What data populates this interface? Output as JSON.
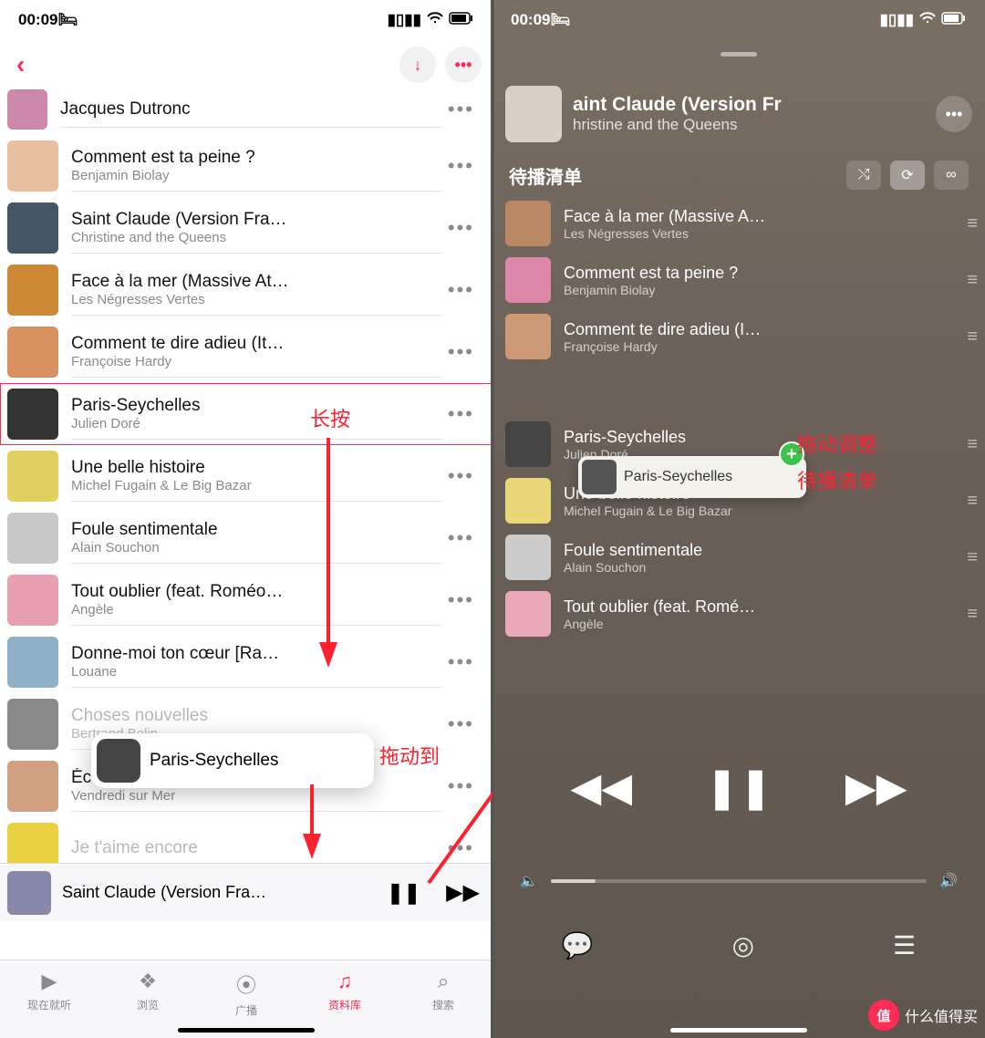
{
  "status": {
    "time": "00:09",
    "icons": {
      "signal": "▮▮",
      "wifi": "⎋",
      "battery": "▮"
    }
  },
  "left": {
    "nav": {
      "back": "‹",
      "download": "↓",
      "more": "•••"
    },
    "songs": [
      {
        "title": "Jacques Dutronc",
        "artist": "",
        "first": true
      },
      {
        "title": "Comment est ta peine ?",
        "artist": "Benjamin Biolay"
      },
      {
        "title": "Saint Claude (Version Fra…",
        "artist": "Christine and the Queens"
      },
      {
        "title": "Face à la mer (Massive At…",
        "artist": "Les Négresses Vertes"
      },
      {
        "title": "Comment te dire adieu (It…",
        "artist": "Françoise Hardy"
      },
      {
        "title": "Paris-Seychelles",
        "artist": "Julien Doré",
        "highlight": true
      },
      {
        "title": "Une belle histoire",
        "artist": "Michel Fugain & Le Big Bazar"
      },
      {
        "title": "Foule sentimentale",
        "artist": "Alain Souchon"
      },
      {
        "title": "Tout oublier (feat. Roméo…",
        "artist": "Angèle"
      },
      {
        "title": "Donne-moi ton cœur [Ra…",
        "artist": "Louane"
      },
      {
        "title": "Choses nouvelles",
        "artist": "Bertrand Belin",
        "faded": true
      },
      {
        "title": "Écoute chérie",
        "artist": "Vendredi sur Mer"
      },
      {
        "title": "Je t'aime encore",
        "artist": "",
        "faded": true
      }
    ],
    "drag_chip": "Paris-Seychelles",
    "miniplayer": {
      "title": "Saint Claude (Version Fra…"
    },
    "tabs": [
      {
        "label": "现在就听",
        "icon": "▶"
      },
      {
        "label": "浏览",
        "icon": "❖"
      },
      {
        "label": "广播",
        "icon": "⦿"
      },
      {
        "label": "资料库",
        "icon": "♫",
        "active": true
      },
      {
        "label": "搜索",
        "icon": "⌕"
      }
    ],
    "annotations": {
      "longpress": "长按",
      "dragto": "拖动到"
    }
  },
  "right": {
    "nowplaying": {
      "title": "aint Claude (Version Fr",
      "artist": "hristine and the Queens"
    },
    "queue_label": "待播清单",
    "queue_buttons": {
      "shuffle": "⤭",
      "repeat": "⟳",
      "autoplay": "∞"
    },
    "queue": [
      {
        "title": "Face à la mer (Massive A…",
        "artist": "Les Négresses Vertes"
      },
      {
        "title": "Comment est ta peine ?",
        "artist": "Benjamin Biolay"
      },
      {
        "title": "Comment te dire adieu (I…",
        "artist": "Françoise Hardy"
      },
      {
        "title": "Paris-Seychelles",
        "artist": "Julien Doré"
      },
      {
        "title": "Une belle histoire",
        "artist": "Michel Fugain & Le Big Bazar"
      },
      {
        "title": "Foule sentimentale",
        "artist": "Alain Souchon"
      },
      {
        "title": "Tout oublier (feat. Romé…",
        "artist": "Angèle"
      }
    ],
    "drag_chip": "Paris-Seychelles",
    "annotations": {
      "line1": "拖动调整",
      "line2": "待播清单"
    },
    "controls": {
      "prev": "◀◀",
      "pause": "❚❚",
      "next": "▶▶"
    },
    "bottom_icons": {
      "lyrics": "💬",
      "airplay": "◎",
      "queue": "☰"
    }
  },
  "watermark": {
    "badge": "值",
    "text": "什么值得买"
  }
}
